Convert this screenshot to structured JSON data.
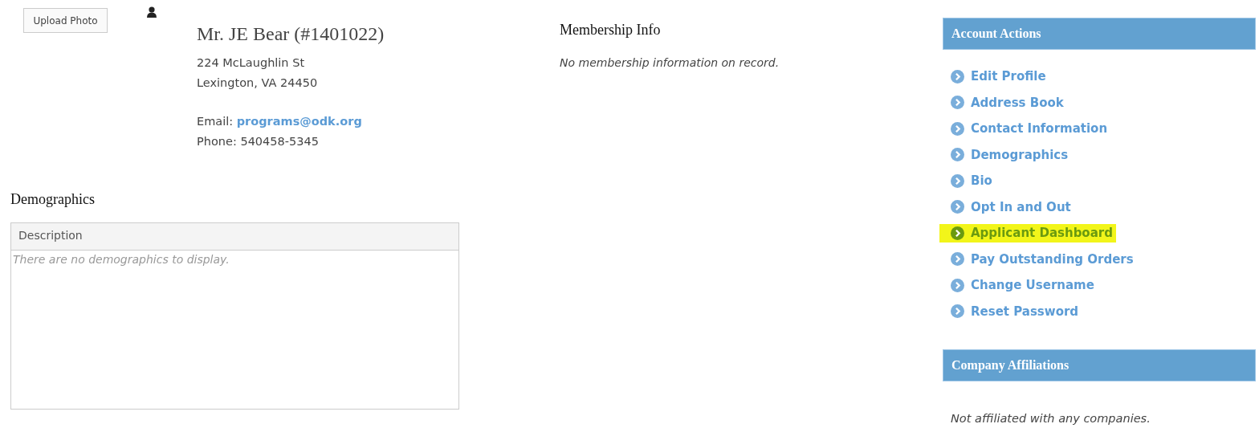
{
  "profile": {
    "upload_button": "Upload Photo",
    "name": "Mr. JE Bear (#1401022)",
    "address_lines": [
      "224 McLaughlin St",
      "Lexington, VA 24450"
    ],
    "email_label": "Email:",
    "email": "programs@odk.org",
    "phone_label": "Phone:",
    "phone": "540458-5345"
  },
  "demographics": {
    "title": "Demographics",
    "columns": [
      "Description"
    ],
    "empty_message": "There are no demographics to display."
  },
  "membership": {
    "title": "Membership Info",
    "message": "No membership information on record."
  },
  "account_actions": {
    "title": "Account Actions",
    "items": [
      {
        "label": "Edit Profile",
        "highlighted": false
      },
      {
        "label": "Address Book",
        "highlighted": false
      },
      {
        "label": "Contact Information",
        "highlighted": false
      },
      {
        "label": "Demographics",
        "highlighted": false
      },
      {
        "label": "Bio",
        "highlighted": false
      },
      {
        "label": "Opt In and Out",
        "highlighted": false
      },
      {
        "label": "Applicant Dashboard",
        "highlighted": true
      },
      {
        "label": "Pay Outstanding Orders",
        "highlighted": false
      },
      {
        "label": "Change Username",
        "highlighted": false
      },
      {
        "label": "Reset Password",
        "highlighted": false
      }
    ]
  },
  "company_affiliations": {
    "title": "Company Affiliations",
    "message": "Not affiliated with any companies."
  }
}
